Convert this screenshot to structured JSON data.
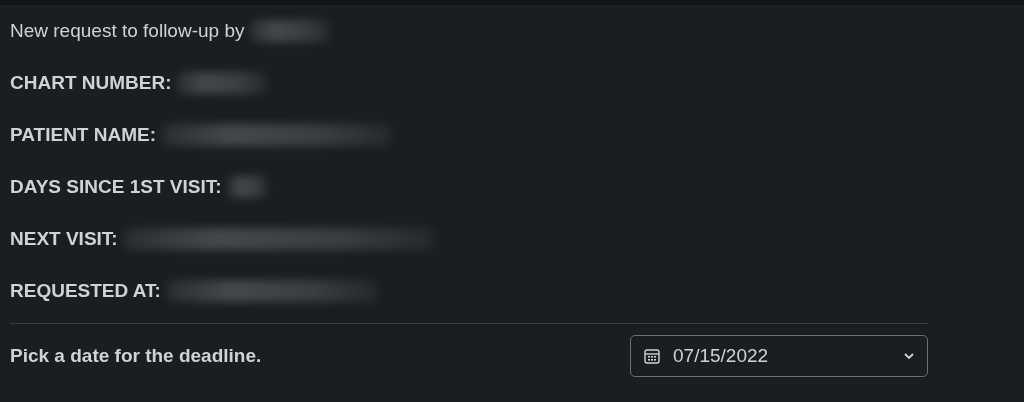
{
  "intro": {
    "text": "New request to follow-up by",
    "redacted": true
  },
  "fields": [
    {
      "label": "CHART NUMBER:",
      "redacted": true
    },
    {
      "label": "PATIENT NAME:",
      "redacted": true
    },
    {
      "label": "DAYS SINCE 1ST VISIT:",
      "redacted": true
    },
    {
      "label": "NEXT VISIT:",
      "redacted": true
    },
    {
      "label": "REQUESTED AT:",
      "redacted": true
    }
  ],
  "deadline": {
    "prompt": "Pick a date for the deadline.",
    "date": "07/15/2022"
  }
}
